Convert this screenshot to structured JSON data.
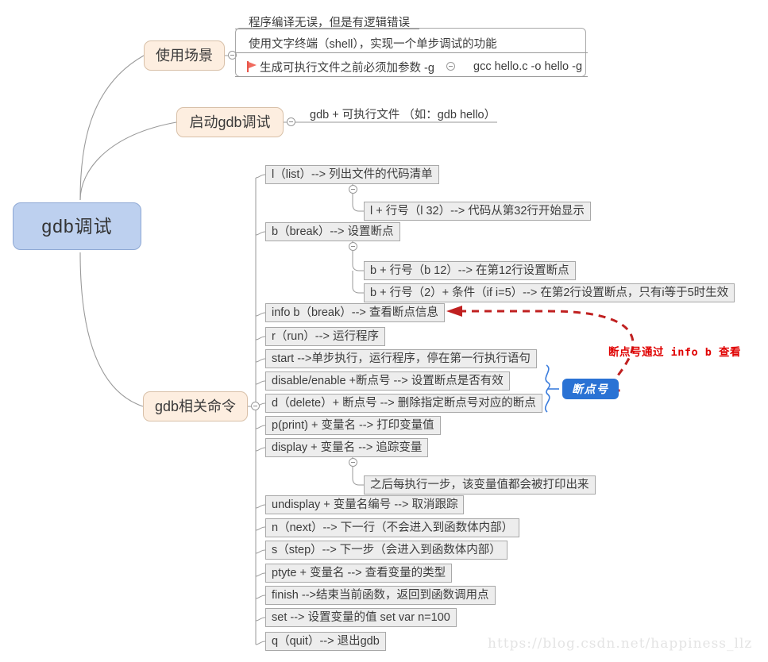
{
  "title": "gdb调试 思维导图",
  "root": {
    "label": "gdb调试"
  },
  "branches": [
    {
      "label": "使用场景"
    },
    {
      "label": "启动gdb调试"
    },
    {
      "label": "gdb相关命令"
    }
  ],
  "scene_rows": [
    {
      "text": "程序编译无误，但是有逻辑错误"
    },
    {
      "text": "使用文字终端（shell），实现一个单步调试的功能"
    }
  ],
  "scene_flag_row": {
    "icon": "flag-icon",
    "text": "生成可执行文件之前必须加参数 -g",
    "detail": "gcc hello.c -o hello -g"
  },
  "start_gdb": {
    "text": "gdb + 可执行文件 （如：gdb hello）"
  },
  "commands": [
    {
      "text": "l（list）--> 列出文件的代码清单"
    },
    {
      "text": "l + 行号（l 32）--> 代码从第32行开始显示",
      "child": true
    },
    {
      "text": "b（break）--> 设置断点"
    },
    {
      "text": "b + 行号（b 12）--> 在第12行设置断点",
      "child": true
    },
    {
      "text": "b + 行号（2）+ 条件（if i=5）--> 在第2行设置断点，只有i等于5时生效",
      "child": true
    },
    {
      "text": "info b（break）--> 查看断点信息"
    },
    {
      "text": "r（run）--> 运行程序"
    },
    {
      "text": "start -->单步执行，运行程序，停在第一行执行语句"
    },
    {
      "text": "disable/enable +断点号 --> 设置断点是否有效"
    },
    {
      "text": "d（delete）+ 断点号 --> 删除指定断点号对应的断点"
    },
    {
      "text": "p(print) + 变量名 --> 打印变量值"
    },
    {
      "text": "display + 变量名 --> 追踪变量"
    },
    {
      "text": "之后每执行一步，该变量值都会被打印出来",
      "child": true
    },
    {
      "text": "undisplay + 变量名编号 --> 取消跟踪"
    },
    {
      "text": "n（next）--> 下一行（不会进入到函数体内部）"
    },
    {
      "text": "s（step）--> 下一步（会进入到函数体内部）"
    },
    {
      "text": "ptyte + 变量名 --> 查看变量的类型"
    },
    {
      "text": "finish -->结束当前函数，返回到函数调用点"
    },
    {
      "text": "set --> 设置变量的值 set var n=100"
    },
    {
      "text": "q（quit）--> 退出gdb"
    }
  ],
  "callout": {
    "label": "断点号"
  },
  "annotation": {
    "text": "断点号通过 info b 查看"
  },
  "watermark": {
    "text": "https://blog.csdn.net/happiness_llz"
  },
  "colors": {
    "root_fill": "#bdd0ef",
    "branch_fill": "#fdeee0",
    "leaf_fill": "#ededed",
    "callout_blue": "#2a72d4",
    "annotation_red": "#e00000",
    "flag_red": "#f06a5e",
    "brace_blue": "#3b7ddd"
  }
}
